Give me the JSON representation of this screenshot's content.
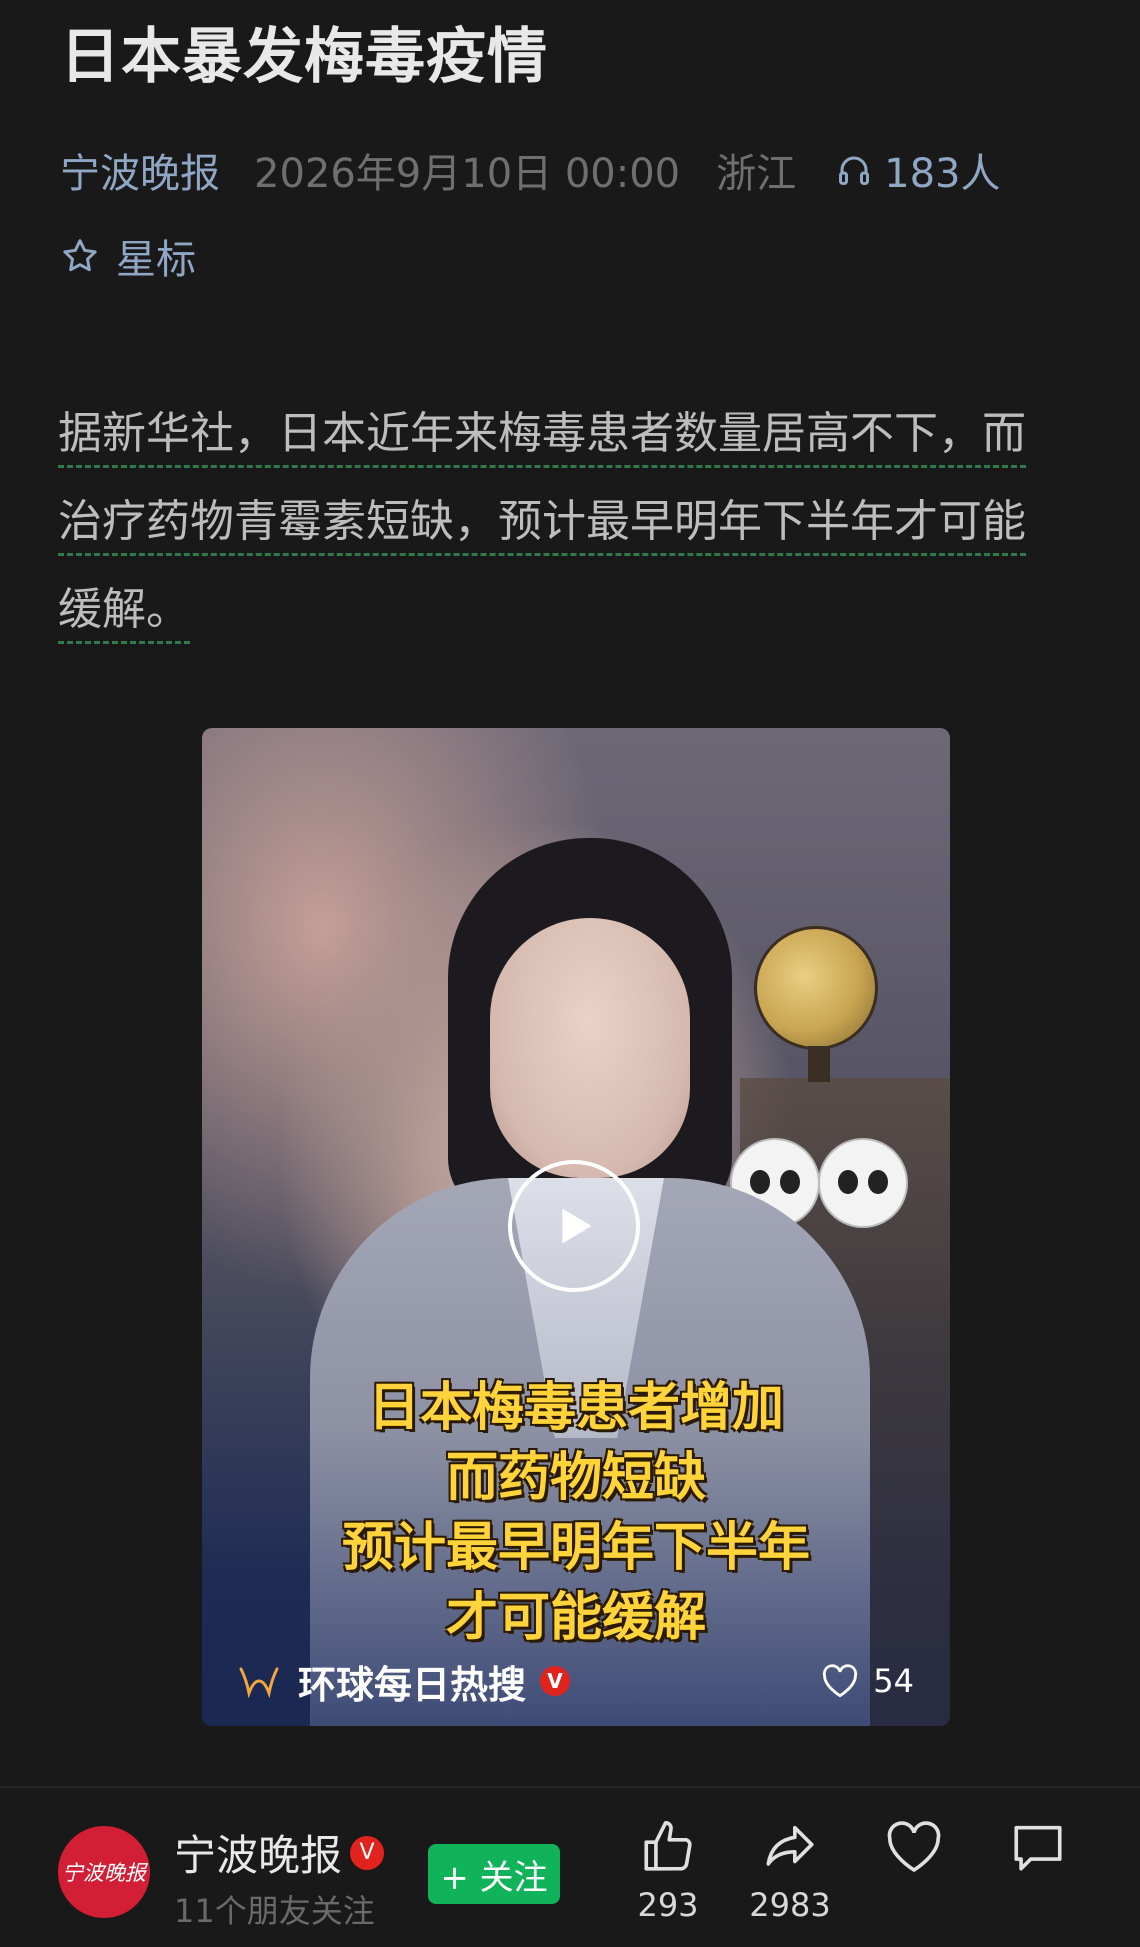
{
  "article": {
    "title": "日本暴发梅毒疫情",
    "source": "宁波晚报",
    "datetime": "2026年9月10日 00:00",
    "region": "浙江",
    "listeners": "183人",
    "star_label": "星标",
    "body_lines": [
      "据新华社，日本近年来梅毒患者数量居高不下，而",
      "治疗药物青霉素短缺，预计最早明年下半年才可能",
      "缓解。"
    ]
  },
  "video": {
    "caption_lines": [
      "日本梅毒患者增加",
      "而药物短缺",
      "预计最早明年下半年",
      "才可能缓解"
    ],
    "channel_name": "环球每日热搜",
    "channel_badge": "V",
    "likes": "54"
  },
  "footer": {
    "avatar_text": "宁波晚报",
    "account_name": "宁波晚报",
    "verified_badge": "V",
    "followers_text": "11个朋友关注",
    "follow_button": "+ 关注",
    "actions": [
      {
        "name": "like",
        "count": "293"
      },
      {
        "name": "share",
        "count": "2983"
      },
      {
        "name": "favorite",
        "count": ""
      },
      {
        "name": "comment",
        "count": ""
      }
    ]
  },
  "icons": [
    "headphones-icon",
    "star-icon",
    "play-icon",
    "channel-logo-icon",
    "heart-icon",
    "thumbs-up-icon",
    "share-icon",
    "favorite-icon",
    "comment-icon"
  ],
  "colors": {
    "background": "#191919",
    "link_blue": "#8fa6c4",
    "follow_green": "#10b35a",
    "caption_yellow": "#ffd33a",
    "avatar_red": "#d21f35"
  }
}
